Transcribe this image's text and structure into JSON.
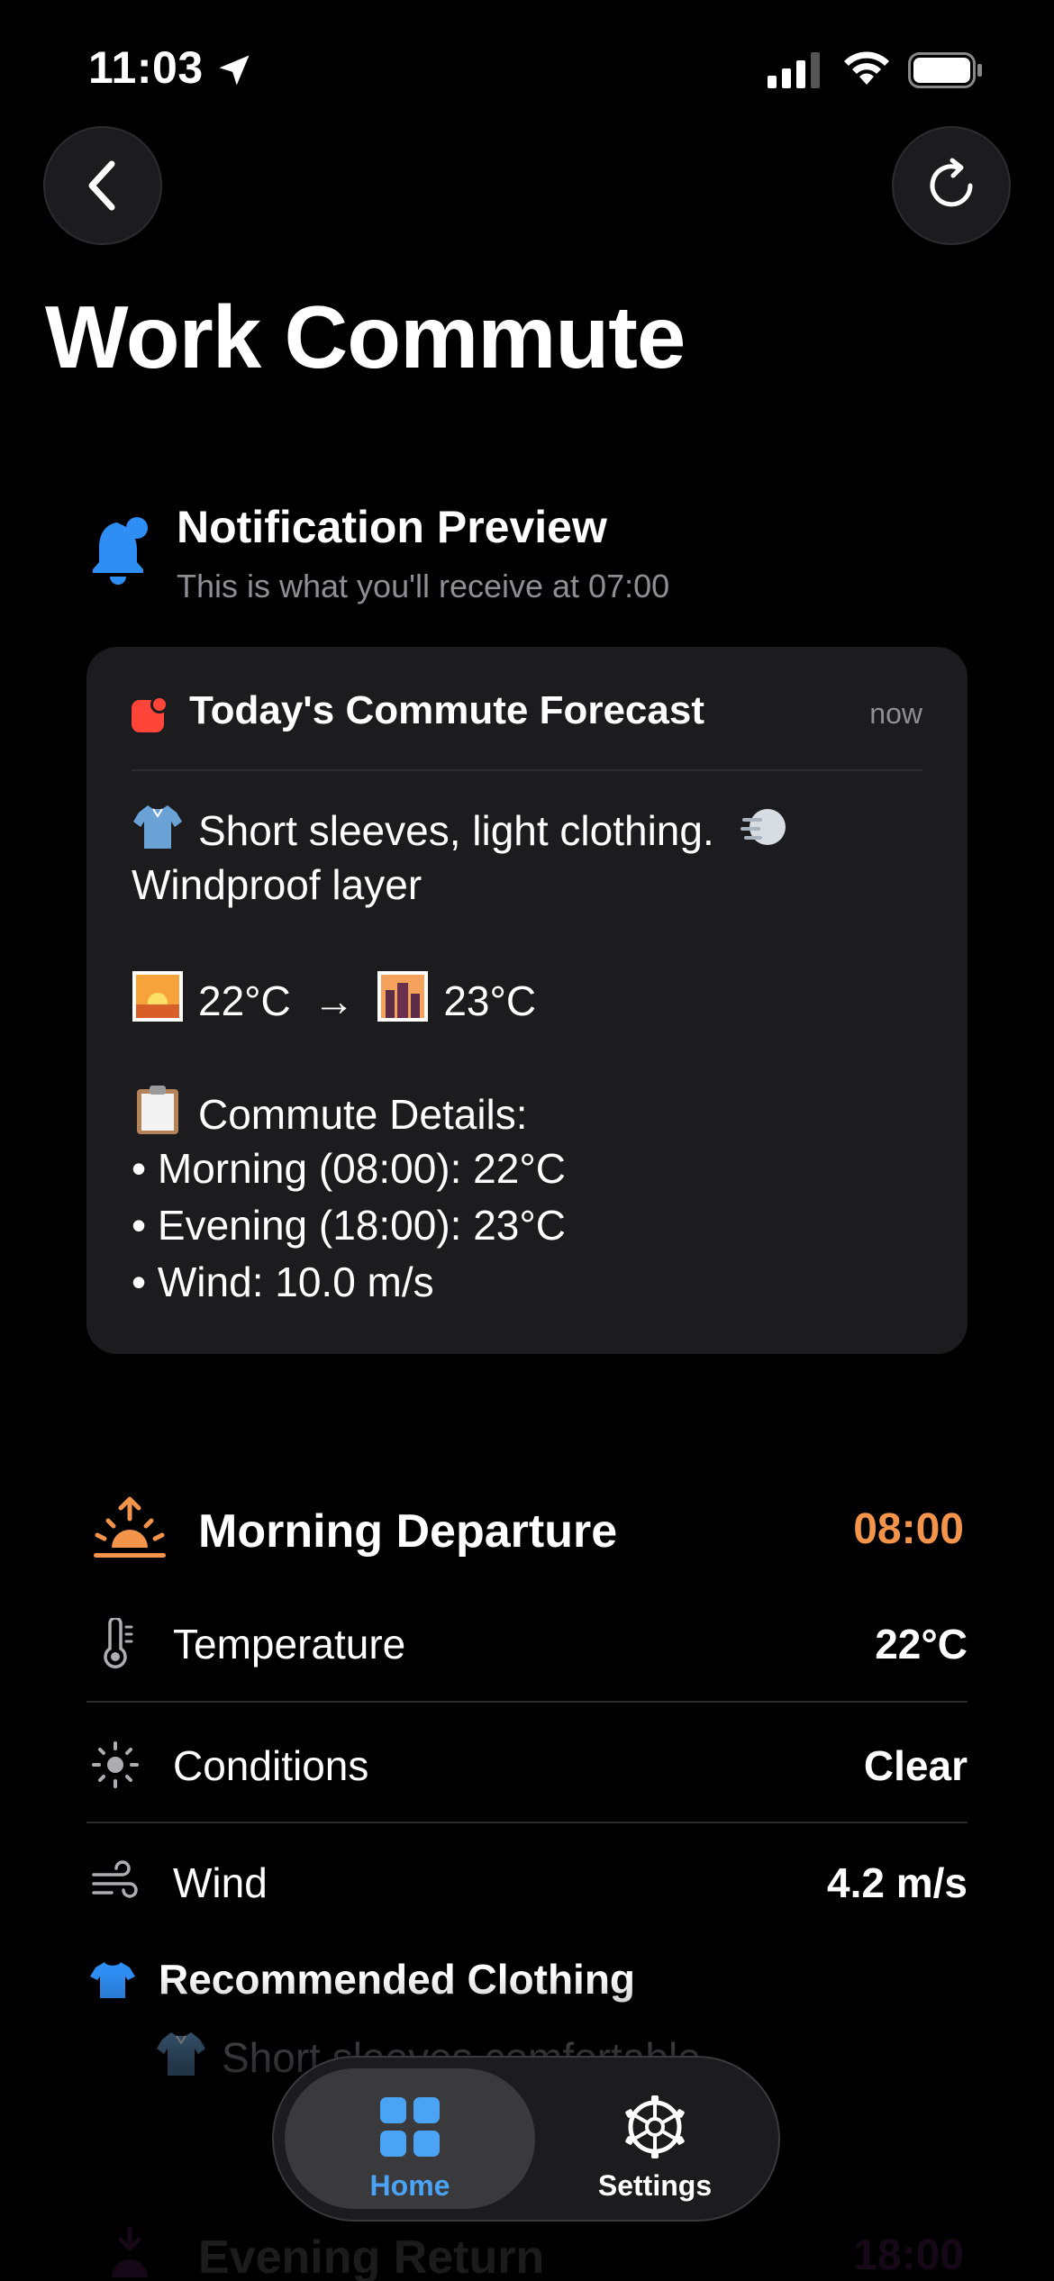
{
  "status_bar": {
    "time": "11:03"
  },
  "header": {
    "title": "Work Commute"
  },
  "notification_preview": {
    "title": "Notification Preview",
    "subtitle": "This is what you'll receive at 07:00",
    "card": {
      "title": "Today's Commute Forecast",
      "time": "now",
      "clothing_line1": "Short sleeves, light clothing.",
      "clothing_line2": "Windproof layer",
      "temp_morning": "22°C",
      "arrow": "→",
      "temp_evening": "23°C",
      "details_heading": "Commute Details:",
      "details": [
        "• Morning (08:00): 22°C",
        "• Evening (18:00): 23°C",
        "• Wind: 10.0 m/s"
      ]
    }
  },
  "morning_departure": {
    "title": "Morning Departure",
    "time": "08:00",
    "rows": [
      {
        "label": "Temperature",
        "value": "22°C",
        "icon": "thermometer-icon"
      },
      {
        "label": "Conditions",
        "value": "Clear",
        "icon": "sun-icon"
      },
      {
        "label": "Wind",
        "value": "4.2 m/s",
        "icon": "wind-icon"
      }
    ],
    "clothing_title": "Recommended Clothing",
    "clothing_item": "Short sleeves comfortable"
  },
  "evening_return": {
    "title": "Evening Return",
    "time": "18:00"
  },
  "tab_bar": {
    "tabs": [
      {
        "label": "Home",
        "icon": "grid-icon",
        "selected": true
      },
      {
        "label": "Settings",
        "icon": "gear-icon",
        "selected": false
      }
    ]
  },
  "colors": {
    "accent_blue": "#4aa3f5",
    "morning_orange": "#f3944a",
    "evening_purple": "#c84bd6",
    "app_red": "#ff453a"
  }
}
